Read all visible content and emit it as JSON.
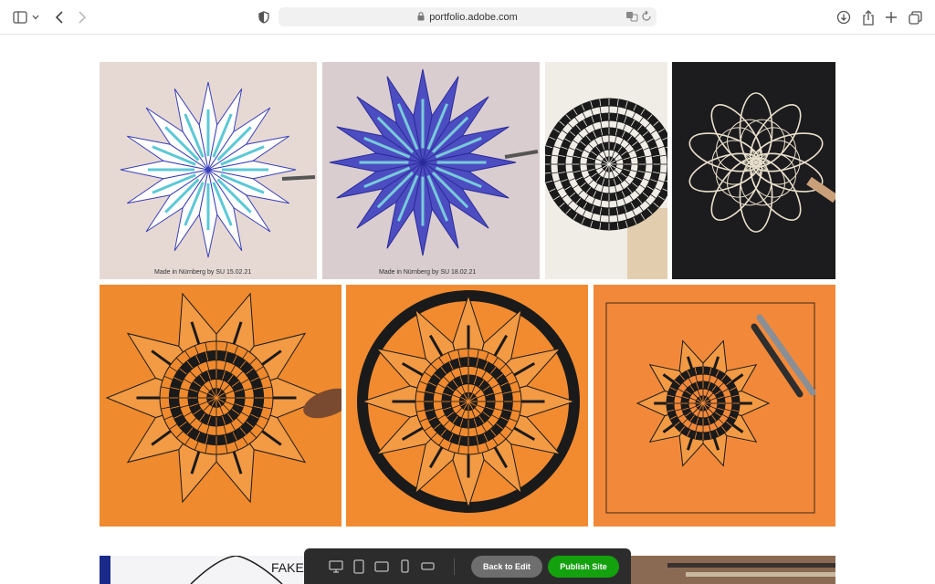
{
  "browser": {
    "url": "portfolio.adobe.com",
    "icons": [
      "sidebar-icon",
      "chevron-down-icon",
      "back-icon",
      "forward-icon",
      "shield-icon",
      "lock-icon",
      "translate-icon",
      "reload-icon",
      "download-icon",
      "share-icon",
      "new-tab-icon",
      "tabs-overview-icon"
    ]
  },
  "gallery": {
    "artworks": [
      {
        "subject": "blue star mandala with cyan patterned petals",
        "caption": "Made in Nürnberg by SU 15.02.21"
      },
      {
        "subject": "blue star mandala with hatched purple petals",
        "caption": "Made in Nürnberg by SU 18.02.21"
      },
      {
        "subject": "black ink circular mandala on white paper"
      },
      {
        "subject": "white line lotus mandala on black paper"
      },
      {
        "subject": "black ink star mandala on orange paper"
      },
      {
        "subject": "black ink ornate mandala on orange paper"
      },
      {
        "subject": "small black mandala on orange paper with pens"
      }
    ],
    "partial_text": "FAKE STRUT"
  },
  "publish_bar": {
    "device_icons": [
      "desktop-icon",
      "tablet-icon",
      "tablet-landscape-icon",
      "phone-icon",
      "phone-landscape-icon"
    ],
    "back_label": "Back to Edit",
    "publish_label": "Publish Site",
    "colors": {
      "bar": "#2c2c2c",
      "back": "#6e6e6e",
      "publish": "#13a10e"
    }
  }
}
